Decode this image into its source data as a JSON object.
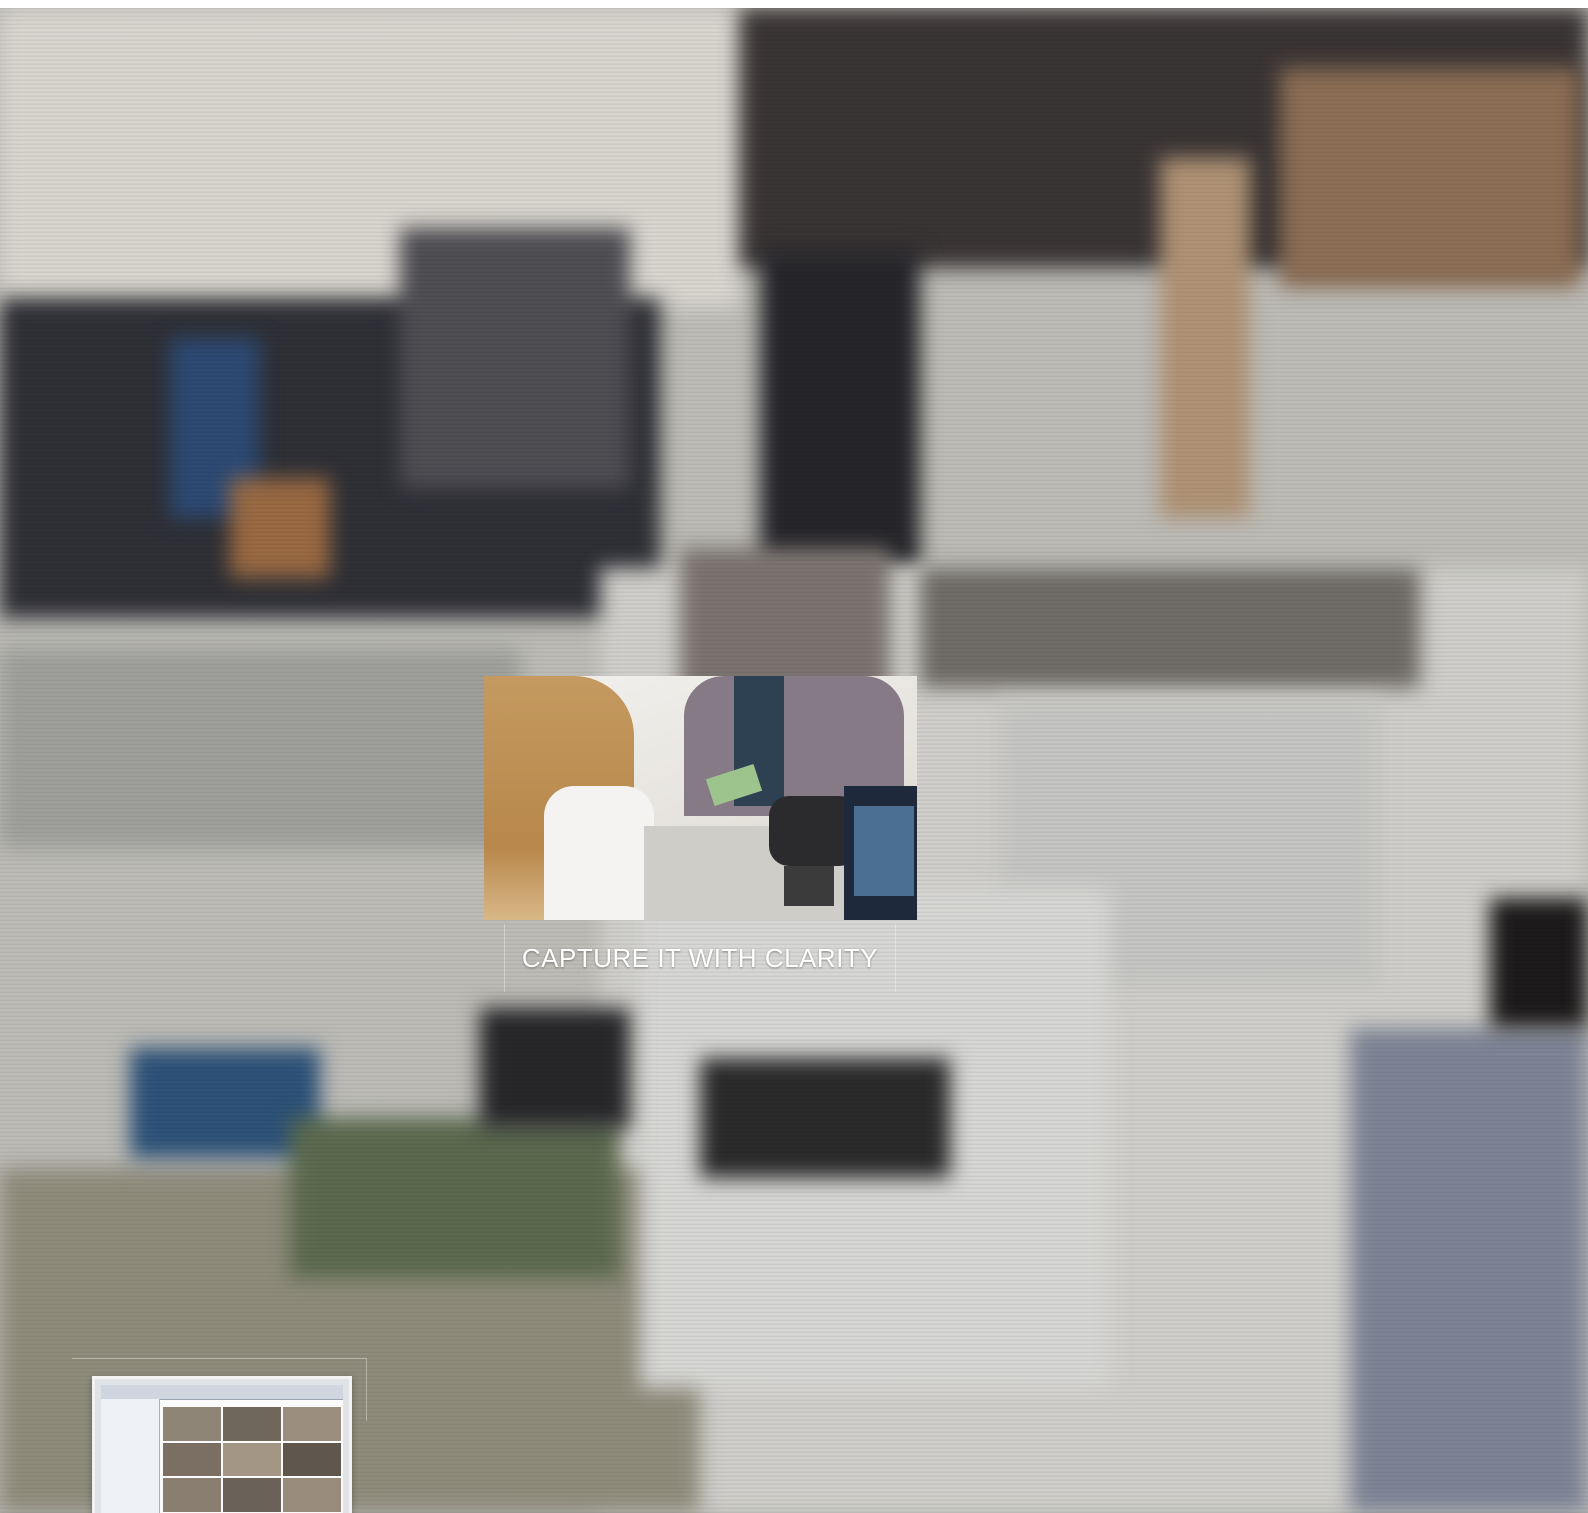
{
  "hero": {
    "caption": "CAPTURE IT WITH CLARITY"
  },
  "thumbnail": {
    "icon": "monitor-software-preview-icon"
  },
  "colors": {
    "background": "#bdbcb7",
    "caption_text": "#ffffff"
  }
}
